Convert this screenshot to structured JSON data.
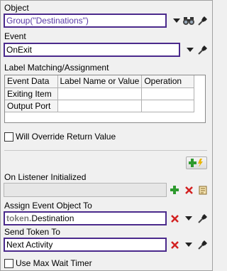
{
  "object": {
    "label": "Object",
    "value": "Group(\"Destinations\")"
  },
  "event": {
    "label": "Event",
    "value": "OnExit"
  },
  "label_matching": {
    "label": "Label Matching/Assignment",
    "columns": [
      "Event Data",
      "Label Name or Value",
      "Operation"
    ],
    "rows": [
      {
        "name": "Exiting Item",
        "value": "",
        "operation": ""
      },
      {
        "name": "Output Port",
        "value": "",
        "operation": ""
      }
    ]
  },
  "override": {
    "label": "Will Override Return Value",
    "checked": false
  },
  "listener": {
    "label": "On Listener Initialized",
    "value": ""
  },
  "assign_event_object": {
    "label": "Assign Event Object To",
    "prefix": "token.",
    "value": "Destination"
  },
  "send_token": {
    "label": "Send Token To",
    "value": "Next Activity"
  },
  "max_wait": {
    "label": "Use Max Wait Timer",
    "checked": false
  },
  "colors": {
    "accent": "#4b2a8c",
    "add_green": "#2e9a2e",
    "delete_red": "#d22020"
  },
  "icons": {
    "binoculars": "binoculars-icon",
    "eyedropper": "eyedropper-icon",
    "dropdown": "dropdown-arrow-icon",
    "add": "add-plus-icon",
    "delete": "delete-x-icon",
    "script": "script-scroll-icon",
    "add_lightning": "add-lightning-icon"
  }
}
